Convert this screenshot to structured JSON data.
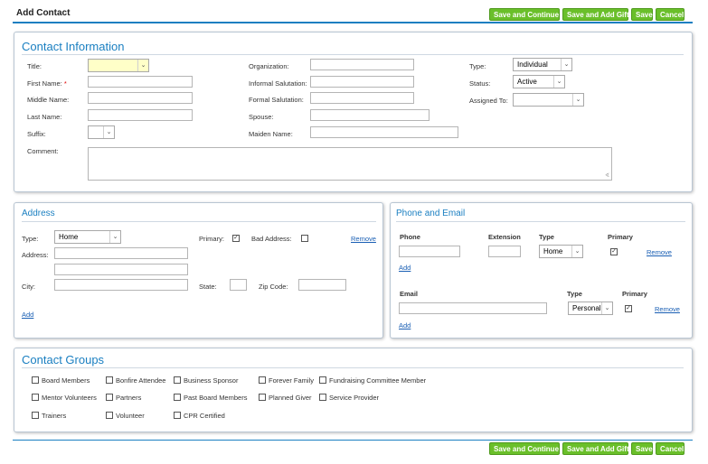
{
  "header": {
    "title": "Add Contact"
  },
  "buttons": {
    "save_and_continue": "Save and Continue",
    "save_and_add_gift": "Save and Add Gift",
    "save": "Save",
    "cancel": "Cancel"
  },
  "contact_info": {
    "title": "Contact Information",
    "labels": {
      "title": "Title:",
      "first_name": "First Name:",
      "required_mark": "*",
      "middle_name": "Middle Name:",
      "last_name": "Last Name:",
      "suffix": "Suffix:",
      "comment": "Comment:",
      "organization": "Organization:",
      "informal_salutation": "Informal Salutation:",
      "formal_salutation": "Formal Salutation:",
      "spouse": "Spouse:",
      "maiden_name": "Maiden Name:",
      "type": "Type:",
      "status": "Status:",
      "assigned_to": "Assigned To:"
    },
    "values": {
      "type": "Individual",
      "status": "Active",
      "title": "",
      "suffix": "",
      "assigned_to": ""
    }
  },
  "address": {
    "title": "Address",
    "labels": {
      "type": "Type:",
      "address": "Address:",
      "city": "City:",
      "primary": "Primary:",
      "bad_address": "Bad Address:",
      "state": "State:",
      "zip_code": "Zip Code:"
    },
    "values": {
      "type": "Home",
      "primary": true,
      "bad_address": false
    },
    "remove": "Remove",
    "add": "Add"
  },
  "phone_email": {
    "title": "Phone and Email",
    "phone_headers": {
      "phone": "Phone",
      "extension": "Extension",
      "type": "Type",
      "primary": "Primary"
    },
    "phone_values": {
      "type": "Home",
      "primary": true
    },
    "email_headers": {
      "email": "Email",
      "type": "Type",
      "primary": "Primary"
    },
    "email_values": {
      "type": "Personal",
      "primary": true
    },
    "remove": "Remove",
    "add": "Add"
  },
  "contact_groups": {
    "title": "Contact Groups",
    "items": [
      "Board Members",
      "Bonfire Attendee",
      "Business Sponsor",
      "Forever Family",
      "Fundraising Committee Member",
      "Mentor Volunteers",
      "Partners",
      "Past Board Members",
      "Planned Giver",
      "Service Provider",
      "Trainers",
      "Volunteer",
      "CPR Certified"
    ]
  },
  "icons": {
    "dropdown": "chevron-down-icon",
    "checkbox": "checkbox-icon",
    "resize": "resize-grip-icon"
  },
  "colors": {
    "accent": "#1a7fc1",
    "button_green": "#6abf2a",
    "required_field": "#ffffc8",
    "link": "#1a5fb4"
  }
}
